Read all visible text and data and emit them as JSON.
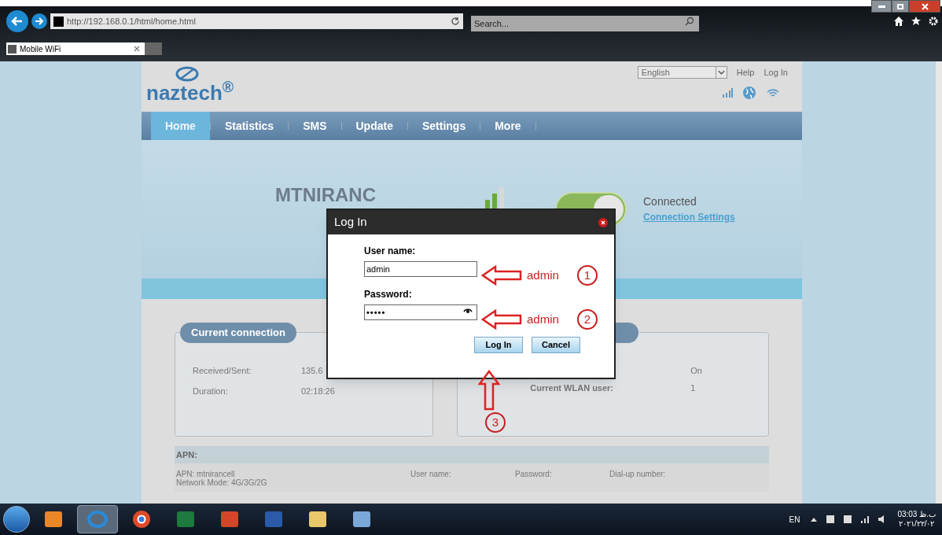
{
  "browser": {
    "url": "http://192.168.0.1/html/home.html",
    "search_placeholder": "Search...",
    "tab_title": "Mobile WiFi"
  },
  "header": {
    "logo": "naztech$^{®}$",
    "language": "English",
    "links": [
      "Help",
      "Log In"
    ]
  },
  "nav": [
    {
      "label": "Home",
      "selected": true
    },
    {
      "label": "Statistics",
      "selected": false
    },
    {
      "label": "SMS",
      "selected": false
    },
    {
      "label": "Update",
      "selected": false
    },
    {
      "label": "Settings",
      "selected": false
    },
    {
      "label": "More",
      "selected": false
    }
  ],
  "banner": {
    "network": "MTNIRANC",
    "connected": true,
    "status": "Connected",
    "link": "Connection Settings"
  },
  "left_card": {
    "title": "Current connection",
    "rows": [
      {
        "label": "Received/Sent:",
        "value": "135.6"
      },
      {
        "label": "Duration:",
        "value": "02:18:26"
      }
    ]
  },
  "right_card": {
    "rows": [
      {
        "value": "On"
      },
      {
        "label": "Current WLAN user:",
        "value": "1"
      }
    ]
  },
  "apn": {
    "title": "APN:",
    "lines": [
      "APN: mtnirancell",
      "Network Mode: 4G/3G/2G"
    ],
    "fields": [
      "User name:",
      "Password:",
      "Dial-up number:"
    ]
  },
  "dialog": {
    "title": "Log In",
    "fields": [
      {
        "label": "User name:",
        "value": "admin",
        "kind": "text"
      },
      {
        "label": "Password:",
        "value": "•••••",
        "kind": "password"
      }
    ],
    "buttons": [
      "Log In",
      "Cancel"
    ]
  },
  "annotations": [
    {
      "label": "admin",
      "number": "1"
    },
    {
      "label": "admin",
      "number": "2"
    },
    {
      "number": "3"
    }
  ],
  "taskbar": {
    "apps": [
      {
        "kind": "media",
        "selected": false
      },
      {
        "kind": "browser",
        "selected": true
      },
      {
        "kind": "chrome",
        "selected": false
      },
      {
        "kind": "excel",
        "selected": false
      },
      {
        "kind": "powerpoint",
        "selected": false
      },
      {
        "kind": "word",
        "selected": false
      },
      {
        "kind": "folder",
        "selected": false
      },
      {
        "kind": "paint",
        "selected": false
      }
    ],
    "language": "EN",
    "time": "03:03 ب.ظ",
    "date": "۲۰۲۱/۲۲/۰۲"
  }
}
